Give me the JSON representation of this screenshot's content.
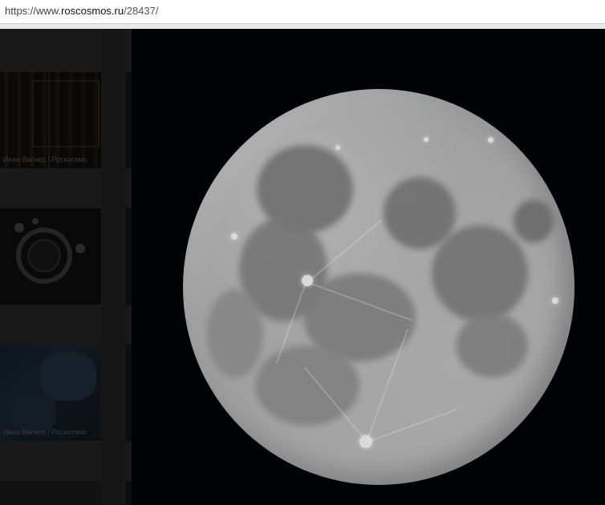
{
  "browser": {
    "url_scheme": "https://www.",
    "url_domain": "roscosmos.ru",
    "url_path": "/28437/"
  },
  "gallery": {
    "thumbnails": [
      {
        "caption": "Иван Вагнер / Роскосмос"
      },
      {
        "caption": ""
      },
      {
        "caption": "Иван Вагнер / Роскосмос"
      },
      {
        "caption": ""
      }
    ]
  },
  "main_image": {
    "subject": "moon"
  },
  "colors": {
    "background": "#000000",
    "address_bar": "#ffffff",
    "gallery_strip": "#191919",
    "moon": "#a9a9a9"
  }
}
